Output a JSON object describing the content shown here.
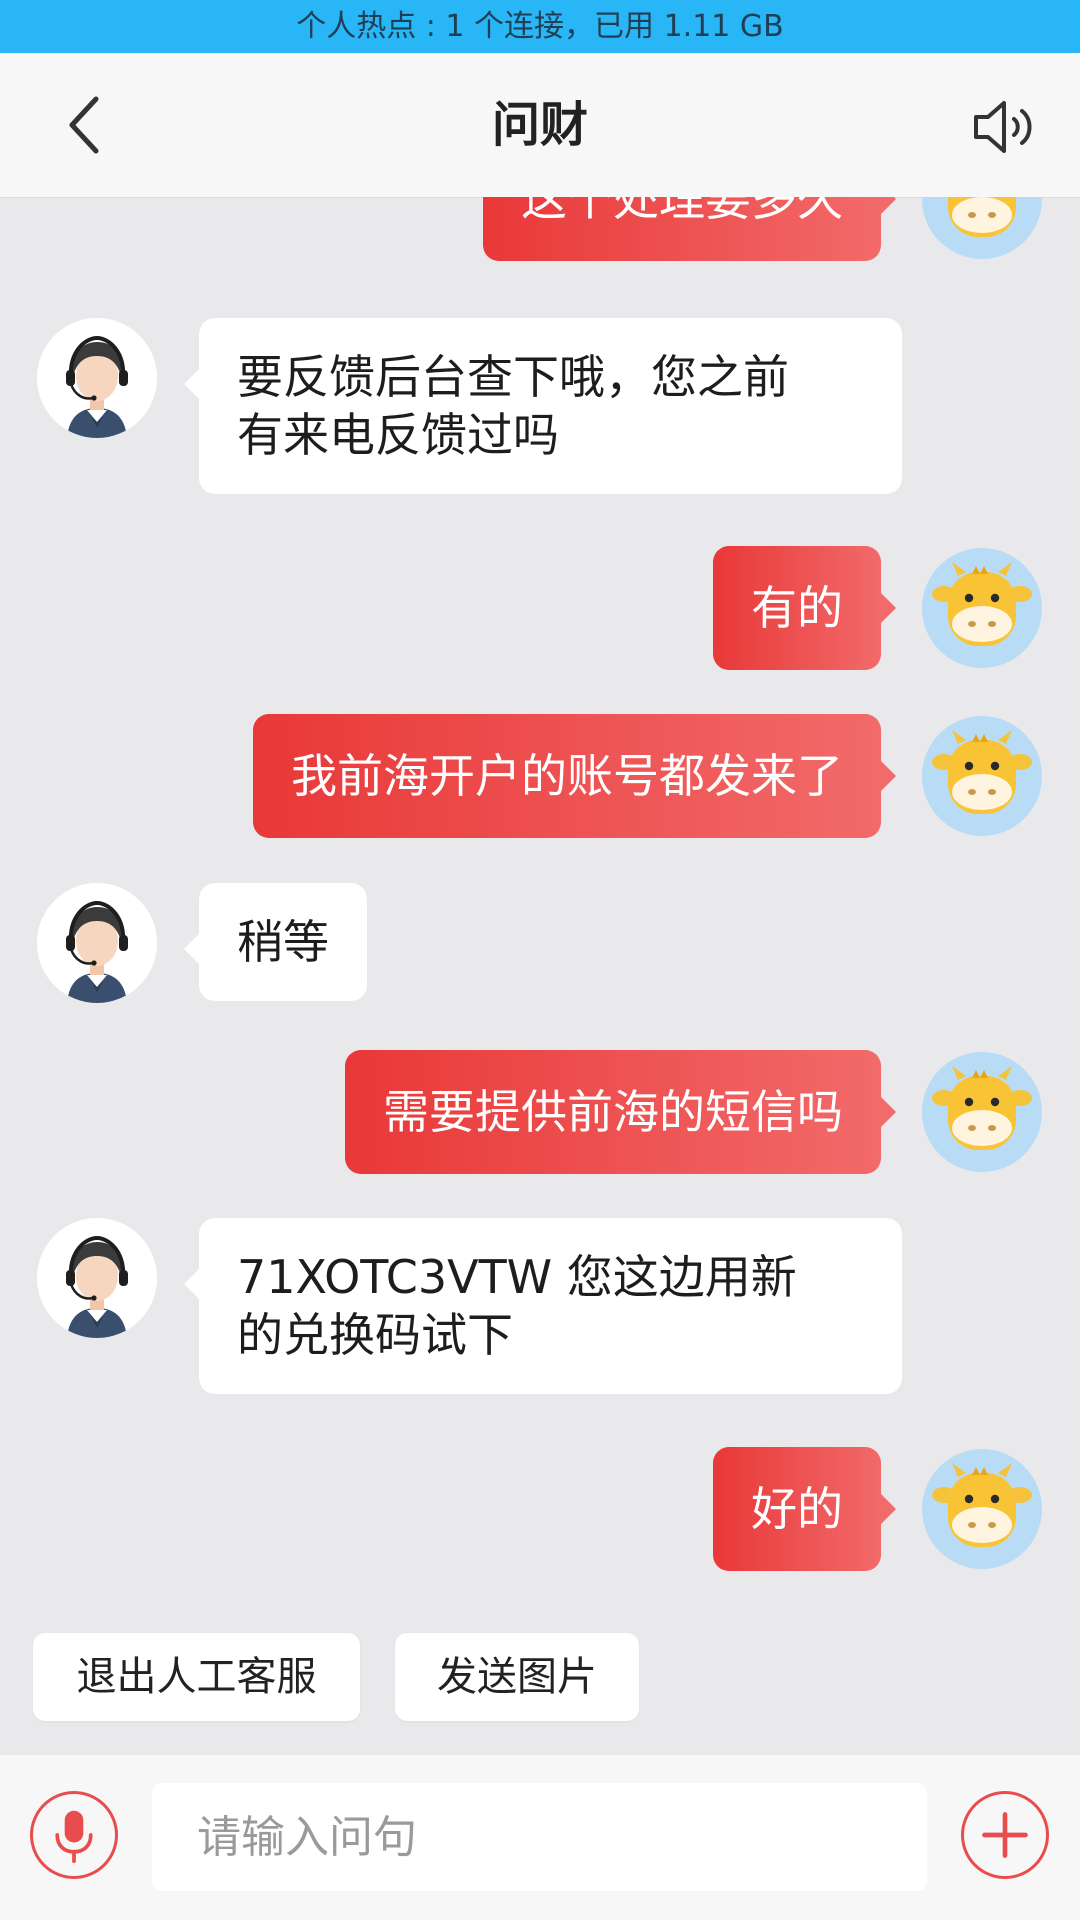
{
  "status_bar": {
    "hotspot_text": "个人热点 : 1 个连接，已用 1.11 GB"
  },
  "header": {
    "title": "问财",
    "back_icon": "chevron-left-icon",
    "speaker_icon": "speaker-icon"
  },
  "messages": [
    {
      "sender": "user",
      "text": "这个处理要多久"
    },
    {
      "sender": "agent",
      "lines": [
        "要反馈后台查下哦，您之前",
        "有来电反馈过吗"
      ]
    },
    {
      "sender": "user",
      "text": "有的"
    },
    {
      "sender": "user",
      "text": "我前海开户的账号都发来了"
    },
    {
      "sender": "agent",
      "lines": [
        "稍等"
      ]
    },
    {
      "sender": "user",
      "text": "需要提供前海的短信吗"
    },
    {
      "sender": "agent",
      "lines": [
        "71XOTC3VTW 您这边用新",
        "的兑换码试下"
      ]
    },
    {
      "sender": "user",
      "text": "好的"
    }
  ],
  "quick_actions": [
    {
      "label": "退出人工客服"
    },
    {
      "label": "发送图片"
    }
  ],
  "input": {
    "placeholder": "请输入问句",
    "value": "",
    "mic_icon": "microphone-icon",
    "plus_icon": "plus-icon"
  },
  "colors": {
    "accent": "#e84c4c",
    "user_bubble_start": "#e93838",
    "user_bubble_end": "#f26a6a",
    "chat_background": "#e9e9ec",
    "hotspot_bar": "#29b6f6"
  }
}
